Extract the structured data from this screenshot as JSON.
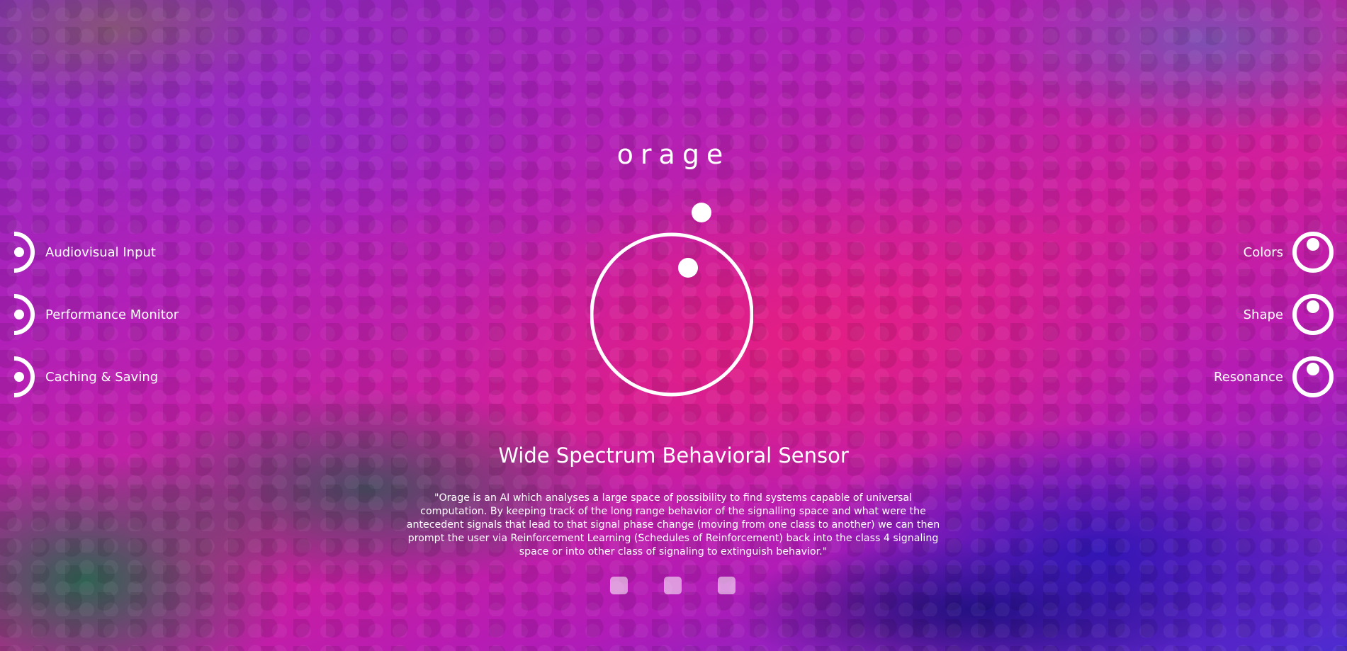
{
  "app": {
    "title": "orage"
  },
  "left_menu": {
    "items": [
      {
        "label": "Audiovisual Input",
        "icon": "half-ring-dot-icon"
      },
      {
        "label": "Performance Monitor",
        "icon": "half-ring-dot-icon"
      },
      {
        "label": "Caching & Saving",
        "icon": "half-ring-dot-icon"
      }
    ]
  },
  "right_menu": {
    "items": [
      {
        "label": "Colors",
        "icon": "ring-dot-icon"
      },
      {
        "label": "Shape",
        "icon": "ring-dot-icon"
      },
      {
        "label": "Resonance",
        "icon": "ring-dot-icon"
      }
    ]
  },
  "main": {
    "section_title": "Wide Spectrum Behavioral Sensor",
    "description": "\"Orage is an AI which analyses a large space of possibility to find systems capable of universal computation. By keeping track of the long range behavior of the signalling space and what were the antecedent signals that lead to that signal phase change (moving from one class to another) we can then prompt the user via Reinforcement Learning (Schedules of Reinforcement) back into the class 4 signaling space or into other class of signaling to extinguish behavior.\""
  },
  "pager": {
    "page_count": 3
  },
  "colors": {
    "foreground": "#ffffff",
    "magenta": "#d21e9a",
    "purple": "#8a2cc4",
    "blue": "#4a2bd0",
    "green": "#146e46"
  }
}
